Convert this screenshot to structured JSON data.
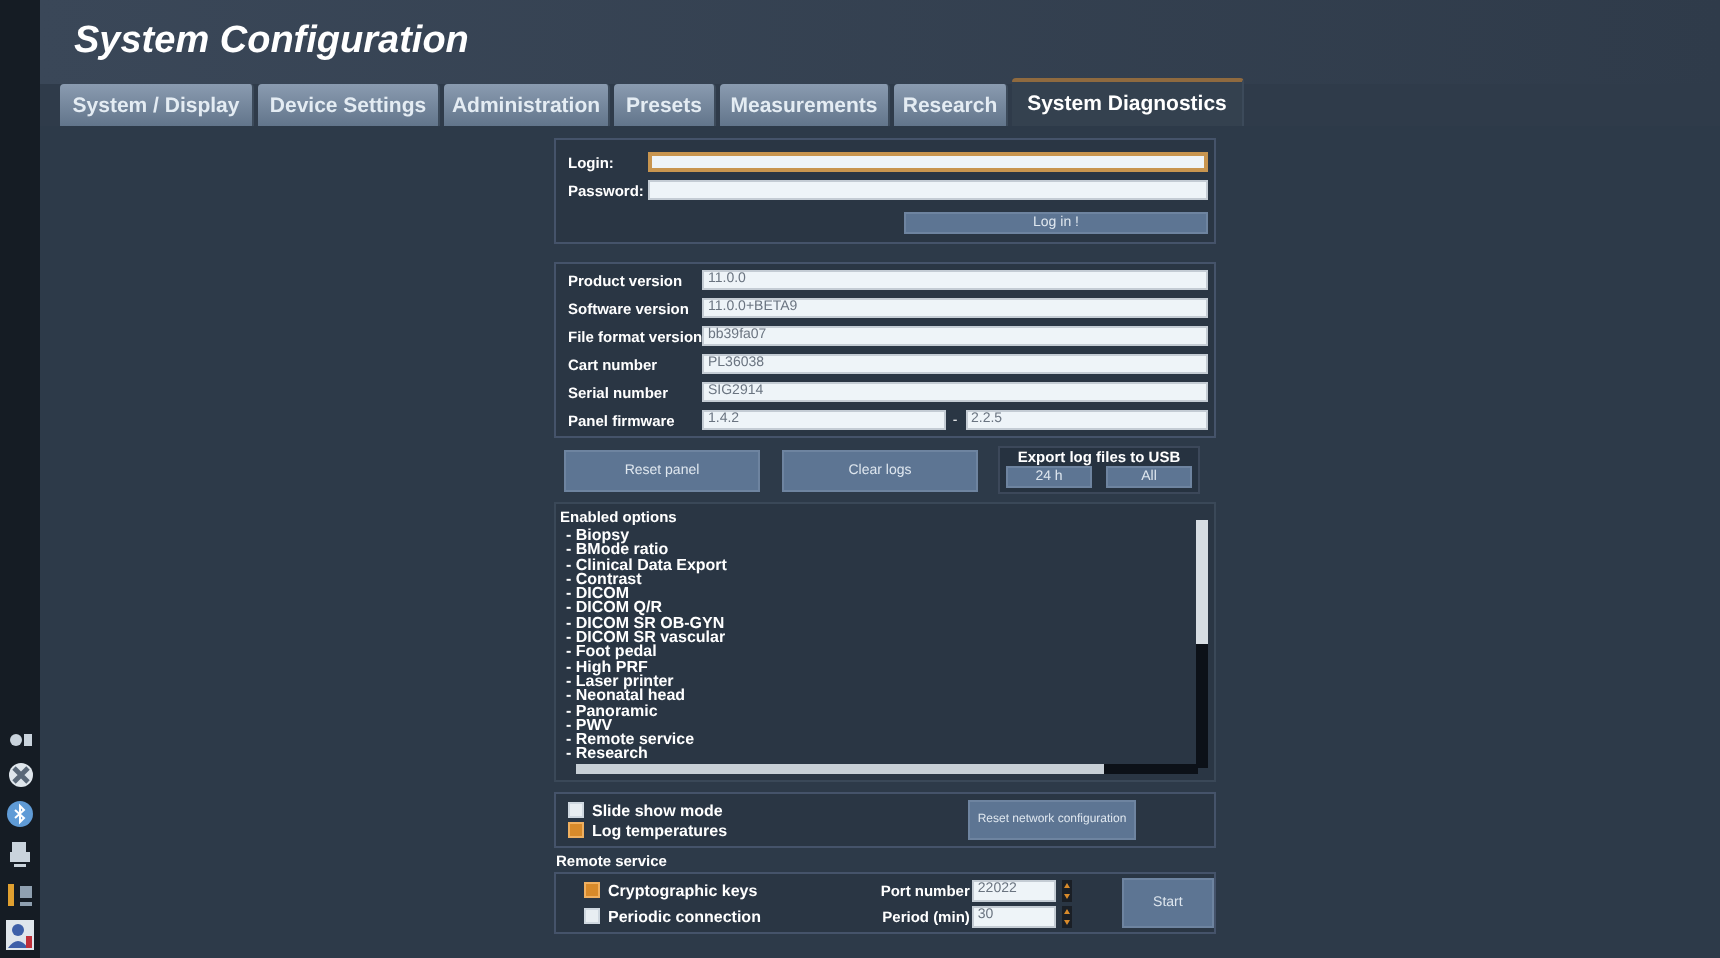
{
  "window": {
    "title": "System Configuration"
  },
  "tabs": [
    {
      "label": "System / Display",
      "selected": false
    },
    {
      "label": "Device Settings",
      "selected": false
    },
    {
      "label": "Administration",
      "selected": false
    },
    {
      "label": "Presets",
      "selected": false
    },
    {
      "label": "Measurements",
      "selected": false
    },
    {
      "label": "Research",
      "selected": false
    },
    {
      "label": "System Diagnostics",
      "selected": true
    }
  ],
  "login": {
    "fields": [
      {
        "label": "Login:",
        "focused": true
      },
      {
        "label": "Password:",
        "focused": false
      }
    ],
    "button": "Log in !"
  },
  "info": {
    "rows": [
      {
        "label": "Product version",
        "values": [
          "11.0.0"
        ]
      },
      {
        "label": "Software version",
        "values": [
          "11.0.0+BETA9"
        ]
      },
      {
        "label": "File format version",
        "values": [
          "bb39fa07"
        ]
      },
      {
        "label": "Cart number",
        "values": [
          "PL36038"
        ]
      },
      {
        "label": "Serial number",
        "values": [
          "SIG2914"
        ]
      },
      {
        "label": "Panel firmware",
        "values": [
          "1.4.2",
          "2.2.5"
        ],
        "separator": "-"
      }
    ]
  },
  "actions": {
    "buttons": [
      "Reset panel",
      "Clear logs"
    ],
    "export": {
      "title": "Export log files to USB",
      "buttons": [
        "24 h",
        "All"
      ]
    }
  },
  "options": {
    "title": "Enabled options",
    "items": [
      "- Biopsy",
      "- BMode ratio",
      "- Clinical Data Export",
      "- Contrast",
      "- DICOM",
      "- DICOM Q/R",
      "- DICOM SR OB-GYN",
      "- DICOM SR vascular",
      "- Foot pedal",
      "- High PRF",
      "- Laser printer",
      "- Neonatal head",
      "- Panoramic",
      "- PWV",
      "- Remote service",
      "- Research"
    ]
  },
  "settings": {
    "checkboxes": [
      {
        "label": "Slide show mode",
        "checked": false
      },
      {
        "label": "Log temperatures",
        "checked": true
      }
    ],
    "button": "Reset network configuration"
  },
  "remote_service": {
    "title": "Remote service",
    "checkboxes": [
      {
        "label": "Cryptographic keys",
        "checked": true
      },
      {
        "label": "Periodic connection",
        "checked": false
      }
    ],
    "fields": [
      {
        "label": "Port number",
        "value": "22022"
      },
      {
        "label": "Period (min)",
        "value": "30"
      }
    ],
    "button": "Start"
  }
}
